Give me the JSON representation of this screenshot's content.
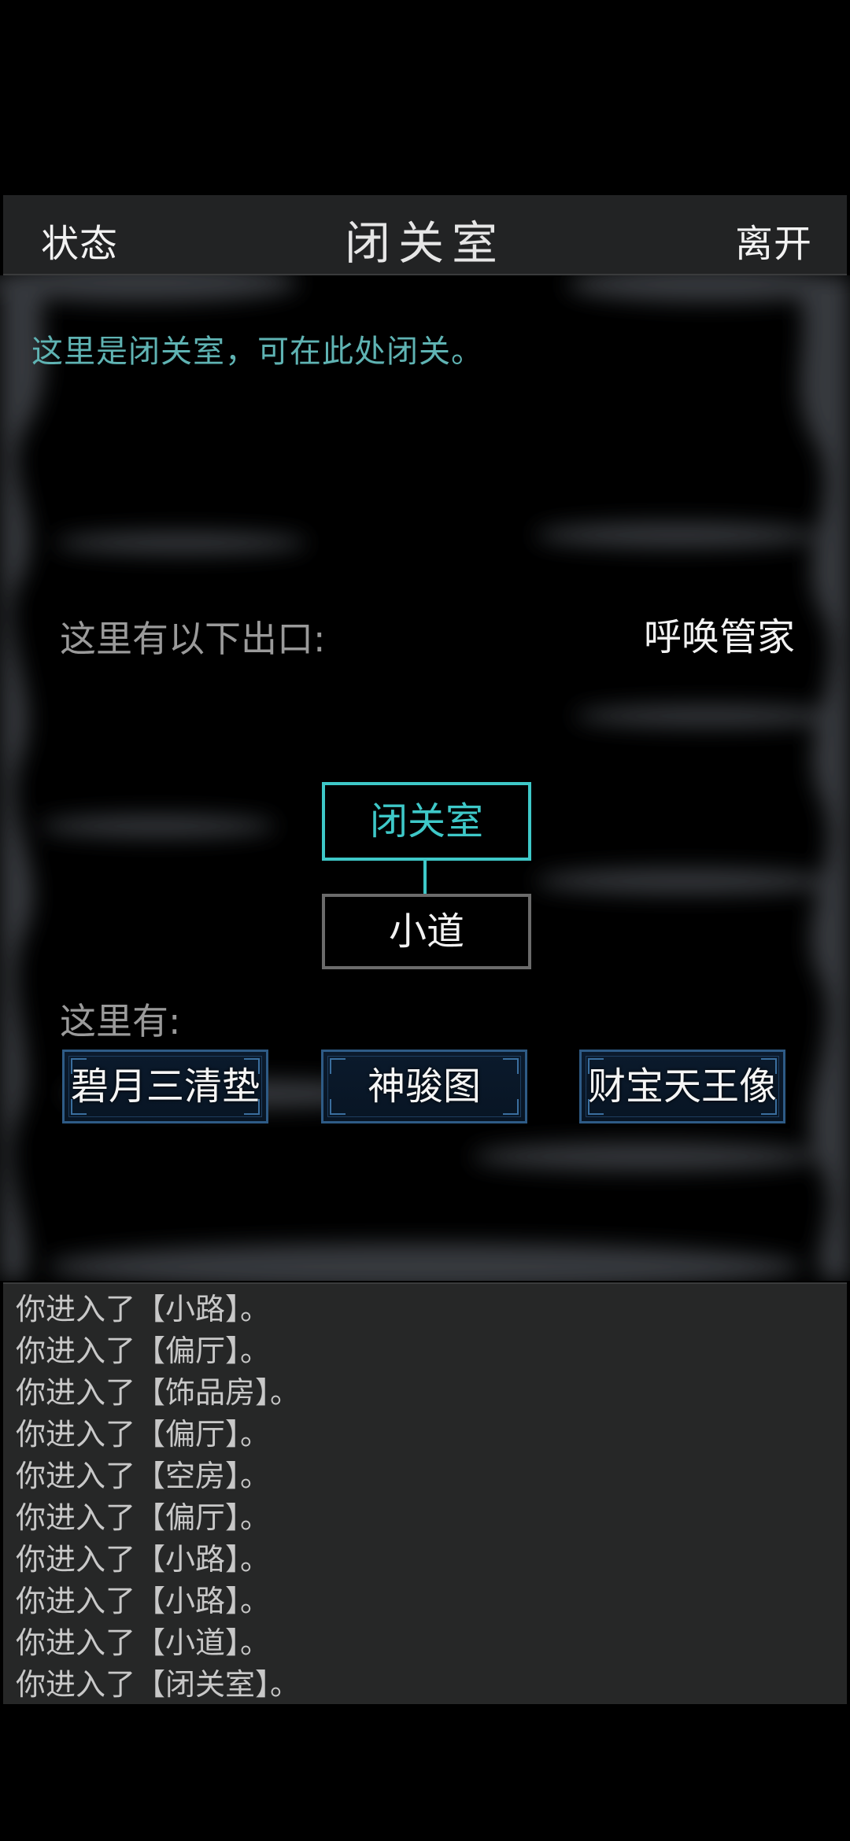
{
  "header": {
    "status_label": "状态",
    "title": "闭关室",
    "leave_label": "离开"
  },
  "room": {
    "description": "这里是闭关室，可在此处闭关。",
    "exits_label": "这里有以下出口:",
    "call_butler_label": "呼唤管家",
    "current_room": "闭关室",
    "exits": [
      "小道"
    ],
    "items_label": "这里有:",
    "items": [
      "碧月三清垫",
      "神骏图",
      "财宝天王像"
    ]
  },
  "log": [
    "你进入了【小路】。",
    "你进入了【偏厅】。",
    "你进入了【饰品房】。",
    "你进入了【偏厅】。",
    "你进入了【空房】。",
    "你进入了【偏厅】。",
    "你进入了【小路】。",
    "你进入了【小路】。",
    "你进入了【小道】。",
    "你进入了【闭关室】。"
  ],
  "colors": {
    "accent": "#3ec8c8",
    "description_text": "#5fb3b3",
    "item_border": "#2e5b86"
  }
}
